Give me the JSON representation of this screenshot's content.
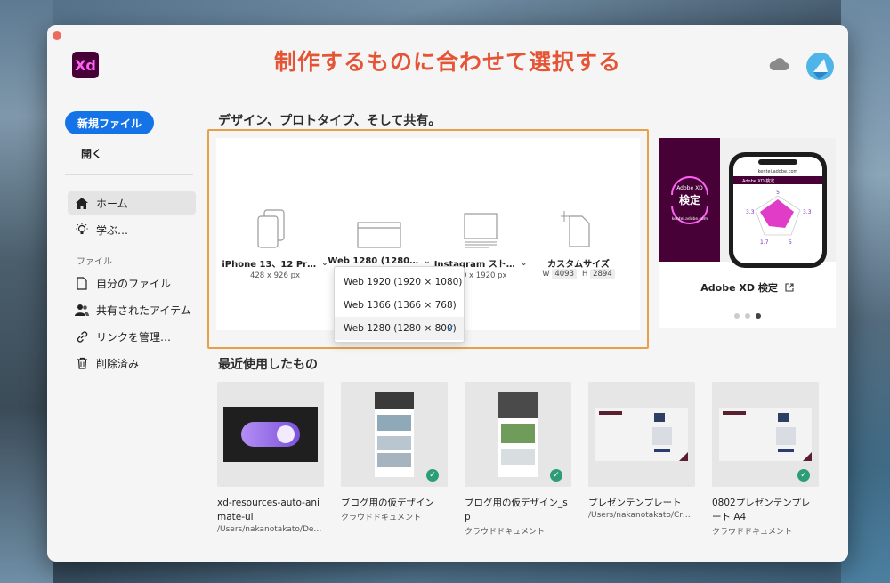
{
  "app": {
    "logo_text": "Xd",
    "banner": "制作するものに合わせて選択する"
  },
  "sidebar": {
    "new_file": "新規ファイル",
    "open": "開く",
    "items": [
      {
        "label": "ホーム",
        "icon": "home-icon",
        "active": true
      },
      {
        "label": "学ぶ…",
        "icon": "lightbulb-icon",
        "active": false
      }
    ],
    "files_section": "ファイル",
    "file_items": [
      {
        "label": "自分のファイル",
        "icon": "document-icon"
      },
      {
        "label": "共有されたアイテム",
        "icon": "shared-users-icon"
      },
      {
        "label": "リンクを管理…",
        "icon": "link-icon"
      },
      {
        "label": "削除済み",
        "icon": "trash-icon"
      }
    ]
  },
  "main": {
    "heading": "デザイン、プロトタイプ、そして共有。",
    "presets": [
      {
        "name": "iPhone 13、12 Pr…",
        "dims": "428 x 926 px"
      },
      {
        "name": "Web 1280 (1280…",
        "dims": ""
      },
      {
        "name": "Instagram スト…",
        "dims": "…0 x 1920 px"
      },
      {
        "name": "カスタムサイズ",
        "w_label": "W",
        "w_value": "4093",
        "h_label": "H",
        "h_value": "2894"
      }
    ],
    "dropdown": {
      "options": [
        "Web 1920 (1920 × 1080)",
        "Web 1366 (1366 × 768)",
        "Web 1280 (1280 × 800)"
      ],
      "selected": "Web 1280 (1280 × 800)"
    },
    "promo": {
      "badge_title": "Adobe XD",
      "badge_main": "検定",
      "badge_url": "kentei.adobe.com",
      "phone_url": "kentei.adobe.com",
      "phone_header": "Adobe XD 検定",
      "phone_val_top": "5",
      "phone_val_left": "3.3",
      "phone_val_right": "3.3",
      "phone_val_bottom_left": "1.7",
      "phone_val_bottom_right": "5",
      "title": "Adobe XD 検定",
      "dots": 3,
      "active_dot": 2
    },
    "recent_heading": "最近使用したもの",
    "recent": [
      {
        "name": "xd-resources-auto-animate-ui",
        "path": "/Users/nakanotakato/Deskt…",
        "synced": false
      },
      {
        "name": "ブログ用の仮デザイン",
        "path": "クラウドドキュメント",
        "synced": true
      },
      {
        "name": "ブログ用の仮デザイン_sp",
        "path": "クラウドドキュメント",
        "synced": true
      },
      {
        "name": "プレゼンテンプレート",
        "path": "/Users/nakanotakato/Creat…",
        "synced": false
      },
      {
        "name": "0802プレゼンテンプレート A4",
        "path": "クラウドドキュメント",
        "synced": true
      }
    ]
  },
  "colors": {
    "accent": "#1473e6",
    "banner": "#e55535",
    "outline": "#e8a048",
    "xd_purple": "#470137",
    "xd_pink": "#ff61f6"
  }
}
